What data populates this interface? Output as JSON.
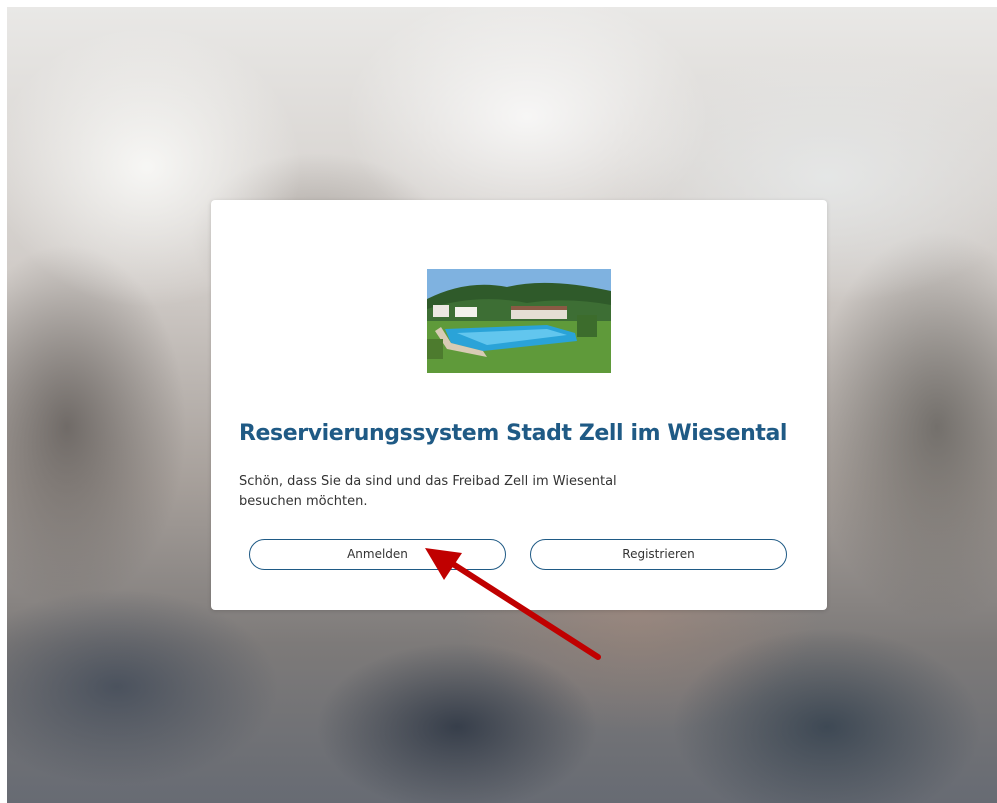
{
  "logo": {
    "icon": "outdoor-pool-photo"
  },
  "title": "Reservierungssystem Stadt Zell im Wiesental",
  "intro": {
    "line1": "Schön, dass Sie da sind und das Freibad Zell im Wiesental",
    "line2": "besuchen möchten."
  },
  "buttons": {
    "login": "Anmelden",
    "register": "Registrieren"
  },
  "annotation": {
    "icon": "red-arrow",
    "color": "#c00000"
  },
  "colors": {
    "accent": "#1f5a85",
    "text": "#333333"
  }
}
